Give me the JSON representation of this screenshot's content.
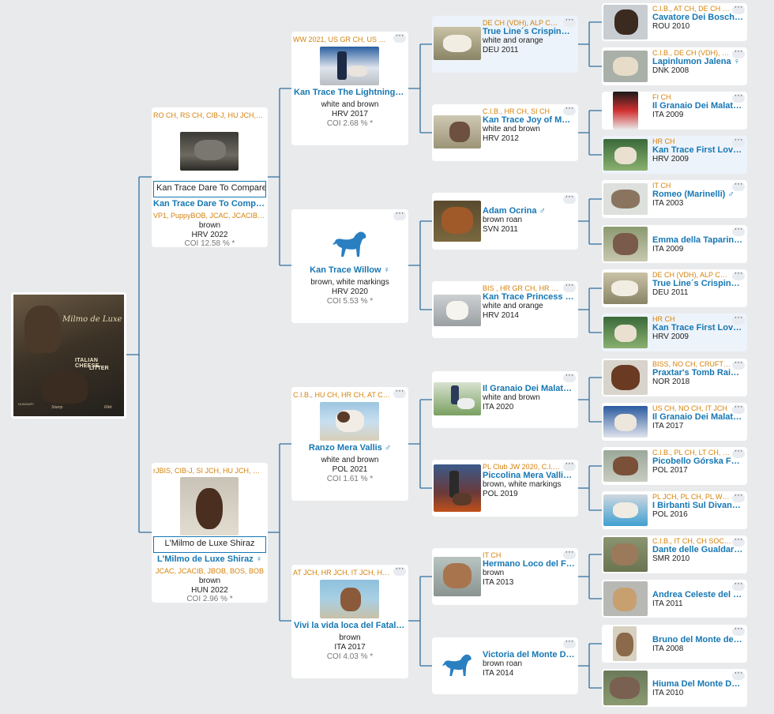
{
  "colors": {
    "accent": "#1677b3",
    "titles": "#d4820c",
    "line": "#2f6f9f"
  },
  "litter": {
    "line1": "ITALIAN CHEESE",
    "line2": "LITTER",
    "logo": "Milmo de Luxe",
    "foot1": "HUNGARY",
    "foot2": "Stamp",
    "foot3": "Rikk"
  },
  "more": "···",
  "silhouette_icon": "dog-silhouette-icon",
  "g1": [
    {
      "titles": "RO CH, RS CH, CIB-J, HU JCH, SI J…",
      "input": "Kan Trace Dare To Compare",
      "name": "Kan Trace Dare To Compa…",
      "titles2": "VP1, PuppyBOB, JCAC, JCACIB, JB…",
      "color": "brown",
      "origin": "HRV 2022",
      "coi": "COI 12.58 % *"
    },
    {
      "titles": "rJBIS, CIB-J, SI JCH, HU JCH, SK JC…",
      "input": "L'Milmo de Luxe Shiraz",
      "name": "L'Milmo de Luxe Shiraz",
      "sex": "♀",
      "titles2": "JCAC, JCACIB, JBOB, BOS, BOB",
      "color": "brown",
      "origin": "HUN 2022",
      "coi": "COI 2.96 % *"
    }
  ],
  "g2": [
    {
      "titles": "WW 2021, US GR CH, US CH, HR…",
      "name": "Kan Trace The Lightning S…",
      "color": "white and brown",
      "origin": "HRV 2017",
      "coi": "COI 2.68 % *"
    },
    {
      "titles": "",
      "name": "Kan Trace Willow",
      "sex": "♀",
      "color": "brown, white markings",
      "origin": "HRV 2020",
      "coi": "COI 5.53 % *"
    },
    {
      "titles": "C.I.B., HU CH, HR CH, AT CH, SI C…",
      "name": "Ranzo Mera Vallis",
      "sex": "♂",
      "color": "white and brown",
      "origin": "POL 2021",
      "coi": "COI 1.61 % *"
    },
    {
      "titles": "AT JCH, HR JCH, IT JCH, HU JCH, S…",
      "name": "Vivi la vida loca del Fatalb…",
      "color": "brown",
      "origin": "ITA 2017",
      "coi": "COI 4.03 % *"
    }
  ],
  "g3": [
    {
      "titles": "DE CH (VDH), ALP CH, GW…",
      "name": "True Line´s Crispino",
      "sex": "♂",
      "color": "white and orange",
      "origin": "DEU 2011"
    },
    {
      "titles": "C.I.B., HR CH, SI CH",
      "name": "Kan Trace Joy of My L…",
      "color": "white and brown",
      "origin": "HRV 2012"
    },
    {
      "titles": "",
      "name": "Adam Ocrina",
      "sex": "♂",
      "color": "brown roan",
      "origin": "SVN 2011"
    },
    {
      "titles": "BIS , HR GR CH, HR CH, SI…",
      "name": "Kan Trace Princess Vi…",
      "color": "white and orange",
      "origin": "HRV 2014"
    },
    {
      "titles": "",
      "name": "Il Granaio Dei Malate…",
      "color": "white and brown",
      "origin": "ITA 2020"
    },
    {
      "titles": "PL Club JW 2020, C.I.B., R…",
      "name": "Piccolina Mera Vallis",
      "sex": "♀",
      "color": "brown, white markings",
      "origin": "POL 2019"
    },
    {
      "titles": "IT CH",
      "name": "Hermano Loco del Fa…",
      "color": "brown",
      "origin": "ITA 2013"
    },
    {
      "titles": "",
      "name": "Victoria del Monte De…",
      "color": "brown roan",
      "origin": "ITA 2014"
    }
  ],
  "g4": [
    {
      "titles": "C.I.B., AT CH, DE CH (VDH),…",
      "name": "Cavatore Dei Boschi D…",
      "origin": "ROU 2010"
    },
    {
      "titles": "C.I.B., DE CH (VDH), DE JCH…",
      "name": "Lapinlumon Jalena",
      "sex": "♀",
      "origin": "DNK 2008"
    },
    {
      "titles": "FI CH",
      "name": "Il Granaio Dei Malate…",
      "origin": "ITA 2009"
    },
    {
      "titles": "HR CH",
      "name": "Kan Trace First Love",
      "sex": "♀",
      "origin": "HRV 2009"
    },
    {
      "titles": "IT CH",
      "name": "Romeo (Marinelli)",
      "sex": "♂",
      "origin": "ITA 2003"
    },
    {
      "titles": "",
      "name": "Emma della Taparina …",
      "origin": "ITA 2009"
    },
    {
      "titles": "DE CH (VDH), ALP CH, GW…",
      "name": "True Line´s Crispino",
      "sex": "♂",
      "origin": "DEU 2011"
    },
    {
      "titles": "HR CH",
      "name": "Kan Trace First Love",
      "sex": "♀",
      "origin": "HRV 2009"
    },
    {
      "titles": "BISS, NO CH, CRUFTS Q' 2…",
      "name": "Praxtar's Tomb Raide…",
      "origin": "NOR 2018"
    },
    {
      "titles": "US CH, NO CH, IT JCH",
      "name": "Il Granaio Dei Malates…",
      "origin": "ITA 2017"
    },
    {
      "titles": "C.I.B., PL CH, LT CH, PL JCH…",
      "name": "Picobello Górska Fant…",
      "origin": "POL 2017"
    },
    {
      "titles": "PL JCH, PL CH, PL W 2017…",
      "name": "I Birbanti Sul Divano …",
      "origin": "POL 2016"
    },
    {
      "titles": "C.I.B., IT CH, CH SOC., WW…",
      "name": "Dante delle Gualdarie…",
      "origin": "SMR 2010"
    },
    {
      "titles": "",
      "name": "Andrea Celeste del Fa…",
      "origin": "ITA 2011"
    },
    {
      "titles": "",
      "name": "Bruno del Monte dell…",
      "origin": "ITA 2008"
    },
    {
      "titles": "",
      "name": "Hiuma Del Monte Dell…",
      "origin": "ITA 2010"
    }
  ]
}
